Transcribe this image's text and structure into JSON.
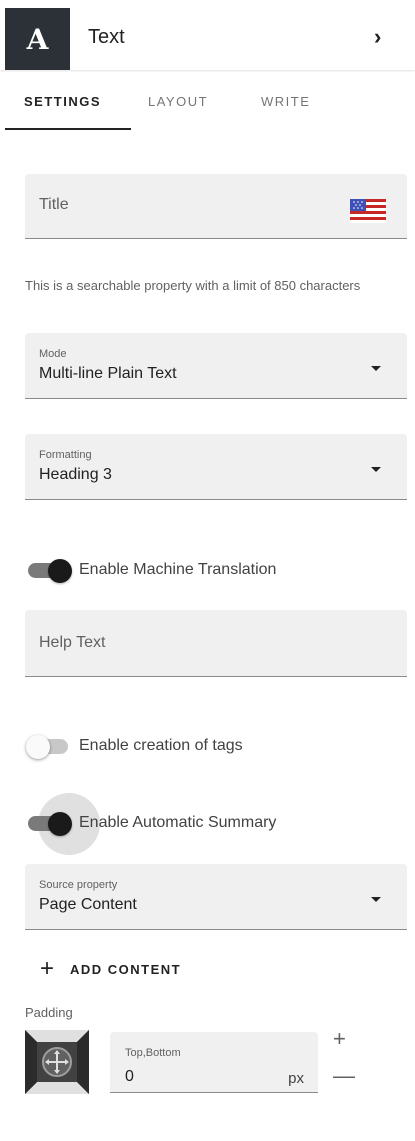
{
  "header": {
    "logo_letter": "A",
    "title": "Text",
    "collapse_icon": "chevron-right-icon"
  },
  "tabs": [
    {
      "label": "SETTINGS",
      "active": true
    },
    {
      "label": "LAYOUT",
      "active": false
    },
    {
      "label": "WRITE",
      "active": false
    }
  ],
  "title_field": {
    "label": "Title",
    "value": "",
    "language_icon": "us-flag-icon",
    "helper": "This is a searchable property with a limit of 850 characters"
  },
  "mode": {
    "label": "Mode",
    "value": "Multi-line Plain Text"
  },
  "formatting": {
    "label": "Formatting",
    "value": "Heading 3"
  },
  "toggles": {
    "machine_translation": {
      "label": "Enable Machine Translation",
      "checked": true
    },
    "creation_of_tags": {
      "label": "Enable creation of tags",
      "checked": false
    },
    "automatic_summary": {
      "label": "Enable Automatic Summary",
      "checked": true
    }
  },
  "help_text": {
    "label": "Help Text",
    "value": ""
  },
  "source_property": {
    "label": "Source property",
    "value": "Page Content"
  },
  "add_content": {
    "label": "ADD CONTENT",
    "icon": "plus-icon"
  },
  "padding": {
    "label": "Padding",
    "field_label": "Top,Bottom",
    "value": "0",
    "unit": "px",
    "increment": "+",
    "decrement": "—"
  },
  "colors": {
    "logo_bg": "#2b3137",
    "field_bg": "#f0f0f0",
    "toggle_on_thumb": "#1a1a1a",
    "toggle_on_track": "#7a7a7a"
  }
}
